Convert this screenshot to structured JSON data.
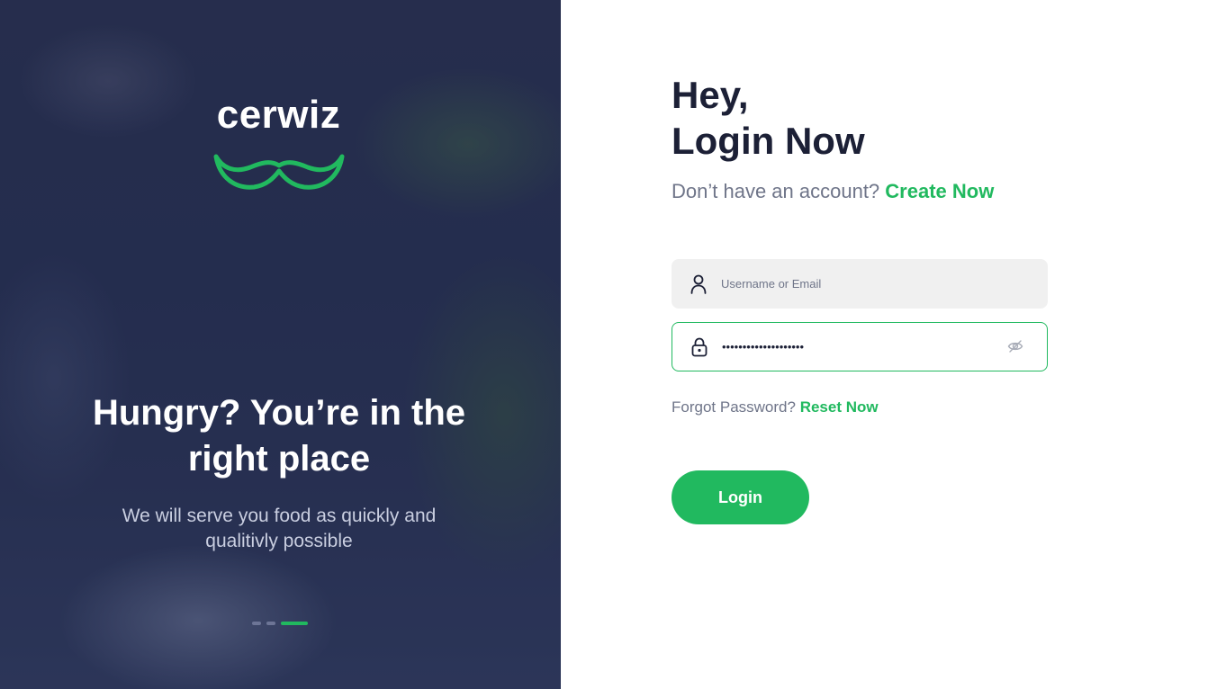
{
  "colors": {
    "accent": "#21b95f",
    "heading": "#1c2036",
    "muted": "#6f7589",
    "hero_overlay": "#273052"
  },
  "hero": {
    "brand_name": "cerwiz",
    "logo_icon": "mustache-icon",
    "tagline": "Hungry? You’re in the right place",
    "subtitle": "We will serve you food as quickly and qualitivly possible",
    "carousel": {
      "slides": 3,
      "active_index": 2
    }
  },
  "login": {
    "title_line1": "Hey,",
    "title_line2": "Login Now",
    "signup_prompt": "Don’t have an account?",
    "signup_link": "Create Now",
    "username": {
      "placeholder": "Username or Email",
      "value": "",
      "icon": "user-icon"
    },
    "password": {
      "value": "••••••••••••••••••••",
      "icon": "lock-icon",
      "toggle_icon": "eye-off-icon"
    },
    "forgot_prompt": "Forgot Password?",
    "forgot_link": "Reset Now",
    "submit_label": "Login"
  }
}
